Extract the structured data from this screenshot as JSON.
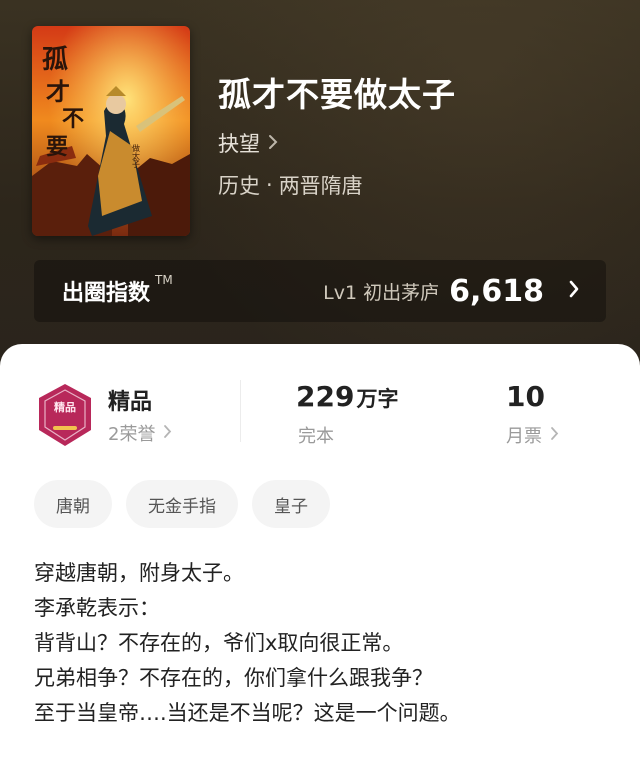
{
  "book": {
    "title": "孤才不要做太子",
    "author": "抉望",
    "category": "历史",
    "separator": "·",
    "subcategory": "两晋隋唐",
    "cover_icon": "book-cover-image",
    "cover_text": "孤才不要做太子"
  },
  "circle_index": {
    "label": "出圈指数",
    "tm": "TM",
    "level": "Lv1 初出茅庐",
    "score": "6,618"
  },
  "stats": {
    "badge_icon": "premium-badge-icon",
    "badge_text": "精品",
    "grade": "精品",
    "honors": "2荣誉",
    "words_num": "229",
    "words_unit": "万字",
    "status": "完本",
    "tickets": "10",
    "tickets_label": "月票"
  },
  "tags": [
    "唐朝",
    "无金手指",
    "皇子"
  ],
  "intro": [
    "穿越唐朝，附身太子。",
    "李承乾表示：",
    "背背山？不存在的，爷们x取向很正常。",
    "兄弟相争？不存在的，你们拿什么跟我争？",
    "至于当皇帝….当还是不当呢？这是一个问题。"
  ],
  "colors": {
    "hero_bg": "#2d261b",
    "card_bg": "#ffffff",
    "badge": "#b8285a",
    "muted_text": "#9a9a9a"
  }
}
